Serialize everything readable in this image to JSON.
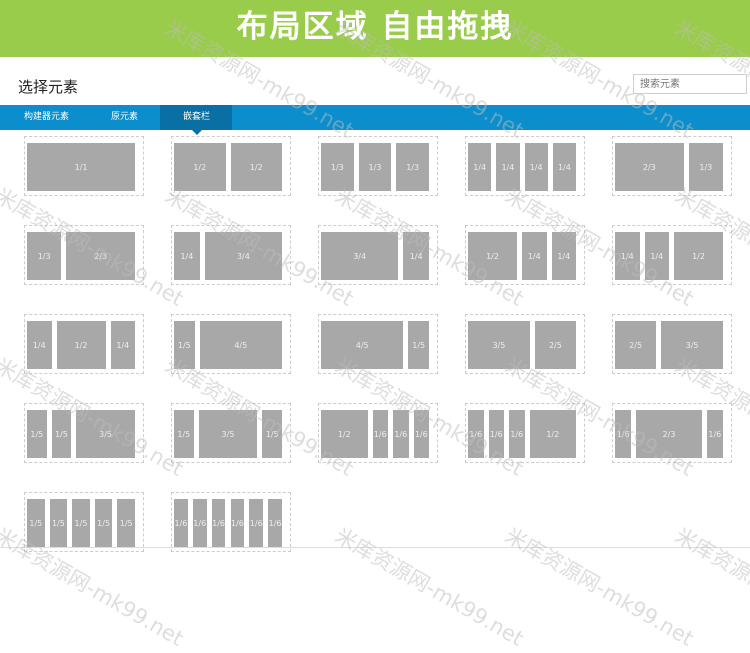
{
  "banner": {
    "title": "布局区域 自由拖拽"
  },
  "header": {
    "title": "选择元素"
  },
  "search": {
    "placeholder": "搜索元素"
  },
  "tabs": [
    {
      "label": "构建器元素"
    },
    {
      "label": "原元素"
    },
    {
      "label": "嵌套栏"
    }
  ],
  "layouts": [
    {
      "cols": [
        "1/1"
      ]
    },
    {
      "cols": [
        "1/2",
        "1/2"
      ]
    },
    {
      "cols": [
        "1/3",
        "1/3",
        "1/3"
      ]
    },
    {
      "cols": [
        "1/4",
        "1/4",
        "1/4",
        "1/4"
      ]
    },
    {
      "cols": [
        "2/3",
        "1/3"
      ]
    },
    {
      "cols": [
        "1/3",
        "2/3"
      ]
    },
    {
      "cols": [
        "1/4",
        "3/4"
      ]
    },
    {
      "cols": [
        "3/4",
        "1/4"
      ]
    },
    {
      "cols": [
        "1/2",
        "1/4",
        "1/4"
      ]
    },
    {
      "cols": [
        "1/4",
        "1/4",
        "1/2"
      ]
    },
    {
      "cols": [
        "1/4",
        "1/2",
        "1/4"
      ]
    },
    {
      "cols": [
        "1/5",
        "4/5"
      ]
    },
    {
      "cols": [
        "4/5",
        "1/5"
      ]
    },
    {
      "cols": [
        "3/5",
        "2/5"
      ]
    },
    {
      "cols": [
        "2/5",
        "3/5"
      ]
    },
    {
      "cols": [
        "1/5",
        "1/5",
        "3/5"
      ]
    },
    {
      "cols": [
        "1/5",
        "3/5",
        "1/5"
      ]
    },
    {
      "cols": [
        "1/2",
        "1/6",
        "1/6",
        "1/6"
      ]
    },
    {
      "cols": [
        "1/6",
        "1/6",
        "1/6",
        "1/2"
      ]
    },
    {
      "cols": [
        "1/6",
        "2/3",
        "1/6"
      ]
    },
    {
      "cols": [
        "1/5",
        "1/5",
        "1/5",
        "1/5",
        "1/5"
      ]
    },
    {
      "cols": [
        "1/6",
        "1/6",
        "1/6",
        "1/6",
        "1/6",
        "1/6"
      ]
    }
  ],
  "watermark": {
    "text": "米库资源网-mk99.net"
  }
}
